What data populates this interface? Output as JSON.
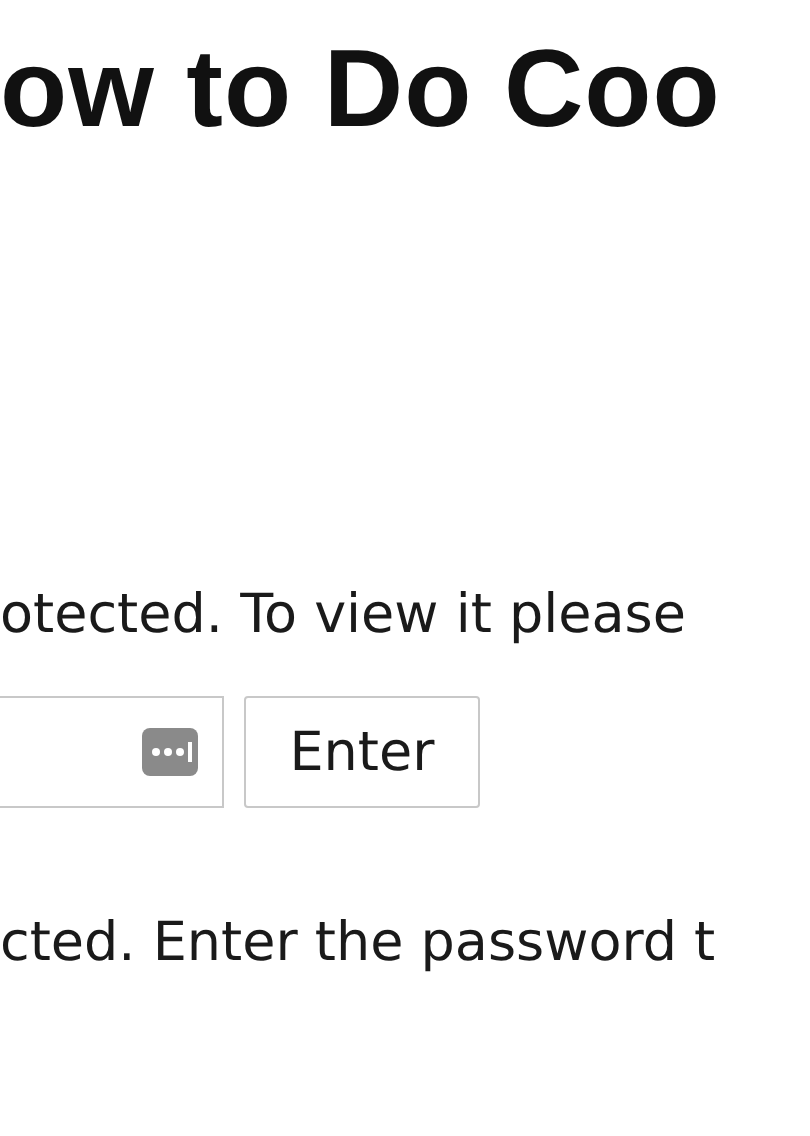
{
  "heading": "ow to Do Coo",
  "notice": "otected. To view it please",
  "password_form": {
    "button": "Enter"
  },
  "footer_text": "cted. Enter the password t"
}
